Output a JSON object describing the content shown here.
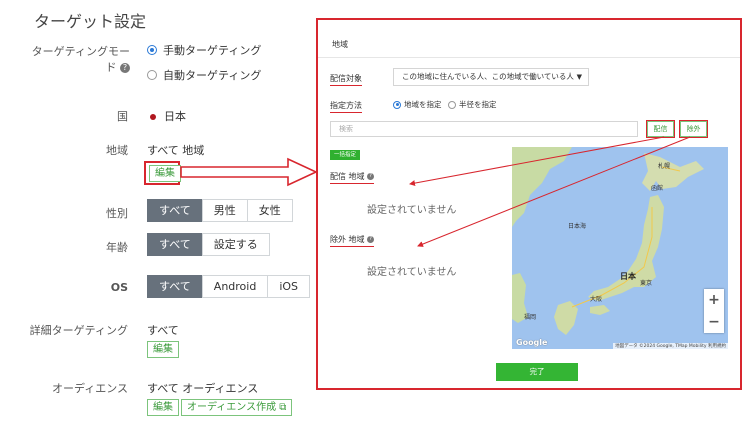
{
  "page": {
    "title": "ターゲット設定"
  },
  "targeting_mode": {
    "label": "ターゲティングモード",
    "options": [
      "手動ターゲティング",
      "自動ターゲティング"
    ],
    "selected": "手動ターゲティング"
  },
  "country": {
    "label": "国",
    "value": "日本"
  },
  "region": {
    "label": "地域",
    "value": "すべて 地域",
    "edit_label": "編集"
  },
  "gender": {
    "label": "性別",
    "options": [
      "すべて",
      "男性",
      "女性"
    ],
    "selected": "すべて"
  },
  "age": {
    "label": "年齢",
    "options": [
      "すべて",
      "設定する"
    ],
    "selected": "すべて"
  },
  "os": {
    "label": "OS",
    "options": [
      "すべて",
      "Android",
      "iOS"
    ],
    "selected": "すべて"
  },
  "detail": {
    "label": "詳細ターゲティング",
    "value": "すべて",
    "edit_label": "編集"
  },
  "audience": {
    "label": "オーディエンス",
    "value": "すべて オーディエンス",
    "edit_label": "編集",
    "create_label": "オーディエンス作成"
  },
  "modal": {
    "title": "地域",
    "target_label": "配信対象",
    "target_value": "この地域に住んでいる人、この地域で働いている人",
    "method_label": "指定方法",
    "method_options": [
      "地域を指定",
      "半径を指定"
    ],
    "method_selected": "地域を指定",
    "search_placeholder": "検索",
    "deliver_button": "配信",
    "exclude_button": "除外",
    "bulk_badge": "一括指定",
    "deliver_area_label": "配信 地域",
    "exclude_area_label": "除外 地域",
    "empty_text": "設定されていません",
    "done_button": "完了",
    "map": {
      "labels": {
        "sapporo": "札幌",
        "hakodate": "函館",
        "sea": "日本海",
        "japan": "日本",
        "tokyo": "東京",
        "osaka": "大阪",
        "fukuoka": "福岡"
      },
      "zoom_in": "+",
      "zoom_out": "−",
      "google": "Google",
      "attribution": "地図データ ©2024 Google, TMap Mobility  利用規約"
    }
  },
  "colors": {
    "accent_red": "#d8262e",
    "green": "#34b534",
    "segment_selected": "#67717c"
  }
}
